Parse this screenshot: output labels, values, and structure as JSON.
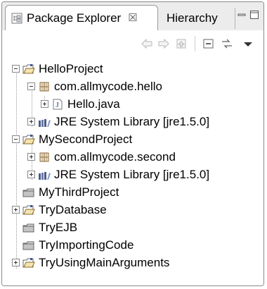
{
  "tabs": {
    "active_label": "Package Explorer",
    "active_close": "☒",
    "inactive_label": "Hierarchy"
  },
  "toolbar": {
    "back_icon": "back-arrow",
    "forward_icon": "forward-arrow",
    "up_icon": "go-up",
    "collapse_icon": "collapse-all",
    "link_icon": "link-with-editor",
    "menu_icon": "view-menu"
  },
  "tree": {
    "hello_project": "HelloProject",
    "hello_package": "com.allmycode.hello",
    "hello_java": "Hello.java",
    "hello_jre": "JRE System Library [jre1.5.0]",
    "second_project": "MySecondProject",
    "second_package": "com.allmycode.second",
    "second_jre": "JRE System Library [jre1.5.0]",
    "third_project": "MyThirdProject",
    "try_database": "TryDatabase",
    "try_ejb": "TryEJB",
    "try_importing": "TryImportingCode",
    "try_main_args": "TryUsingMainArguments"
  },
  "colors": {
    "project_folder": "#e8c868",
    "package_icon": "#8a6a3a",
    "library_icon": "#4a5a8a",
    "java_file": "#5a7ab0"
  }
}
